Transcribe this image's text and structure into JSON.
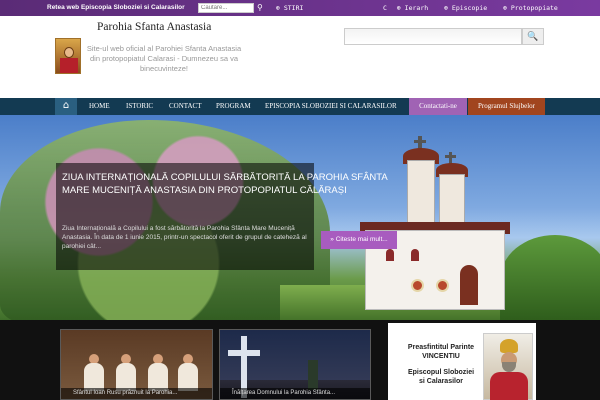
{
  "topbar": {
    "site_label": "Retea web Episcopia Sloboziei si Calarasilor",
    "search_placeholder": "Cautare...",
    "news_label": "STIRI",
    "right_links": [
      "C",
      "Ierarh",
      "Episcopie",
      "Protopopiate"
    ]
  },
  "header": {
    "title": "Parohia Sfanta Anastasia",
    "tagline": "Site-ul web oficial al Parohiei Sfanta Anastasia din protopopiatul Calarasi - Dumnezeu sa va binecuvinteze!"
  },
  "nav": {
    "items": [
      "HOME",
      "ISTORIC",
      "CONTACT",
      "PROGRAM",
      "EPISCOPIA SLOBOZIEI SI CALARASILOR"
    ],
    "contact_button": "Contactati-ne",
    "program_button": "Programul Slujbelor"
  },
  "hero": {
    "title": "ZIUA INTERNAȚIONALĂ COPILULUI SĂRBĂTORITĂ LA PAROHIA SFÂNTA MARE MUCENIȚĂ ANASTASIA DIN PROTOPOPIATUL CĂLĂRAȘI",
    "excerpt": "Ziua Internațională a Copilului a fost sărbătorită la Parohia Sfânta Mare Muceniță Anastasia. În data de 1 iunie 2015, printr-un spectacol oferit de grupul de cateheză al parohiei cât...",
    "read_more": "» Citeste mai mult..."
  },
  "cards": [
    {
      "title": "Sfântul Ioan Rusu prăznuit la Parohia..."
    },
    {
      "title": "Înălțarea Domnului la Parohia Sfânta..."
    }
  ],
  "bishop": {
    "line1": "Preasfintitul Parinte",
    "line2": "VINCENTIU",
    "line3": "Episcopul Sloboziei",
    "line4": "si Calarasilor"
  },
  "colors": {
    "topbar": "#6a3390",
    "nav": "#133a52",
    "contact_button": "#a063b4",
    "program_button": "#a1451f",
    "read_more": "#a85cbf"
  }
}
